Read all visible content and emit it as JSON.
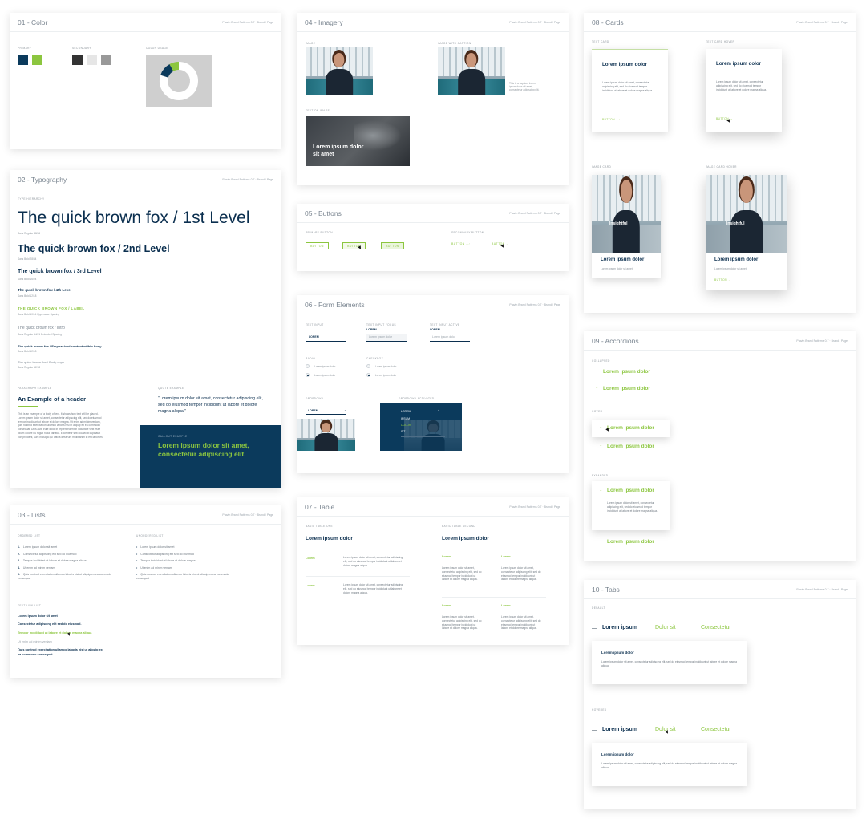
{
  "meta": "Pravin Brand Patterns 0.7",
  "meta_link": "Brand / Page",
  "color": {
    "title": "01 - Color",
    "primary_label": "PRIMARY",
    "secondary_label": "SECONDARY",
    "usage_label": "COLOR USAGE",
    "primary_swatches": [
      "#0b3a5c",
      "#8cc63f"
    ],
    "secondary_swatches": [
      "#333333",
      "#e6e6e6",
      "#999999"
    ],
    "donut": [
      {
        "color": "#ffffff",
        "value": 80
      },
      {
        "color": "#0b3a5c",
        "value": 12
      },
      {
        "color": "#8cc63f",
        "value": 8
      }
    ]
  },
  "typography": {
    "title": "02 - Typography",
    "type_label": "TYPE HIERARCHY",
    "levels": [
      {
        "text": "The quick brown fox / 1st Level",
        "note": "Sans Regular 48/56"
      },
      {
        "text": "The quick brown fox / 2nd Level",
        "note": "Sans Bold 28/34"
      },
      {
        "text": "The quick brown fox / 3rd Level",
        "note": "Sans Bold 16/24"
      },
      {
        "text": "The quick brown fox / 4th Level",
        "note": "Sans Bold 12/18"
      },
      {
        "text": "THE QUICK BROWN FOX / LABEL",
        "note": "Sans Bold 10/14 Uppercase Spacing"
      },
      {
        "text": "The quick brown fox / Intro",
        "note": "Sans Regular 14/21 Extended Spacing"
      },
      {
        "text": "The quick brown fox / Emphasized content within body",
        "note": "Sans Bold 12/18"
      },
      {
        "text": "The quick brown fox / Body copy",
        "note": "Sans Regular 12/18"
      }
    ],
    "paragraph_label": "PARAGRAPH EXAMPLE",
    "paragraph_header": "An Example of a header",
    "paragraph_body": "This is an example of a body of text. It shows how text will be placed. Lorem ipsum dolor sit amet, consectetur adipiscing elit, sed do eiusmod tempor incididunt ut labore et dolore magna. Ut enim ad minim veniam, quis nostrud exercitation ullamco laboris nisi ut aliquip ex ea commodo consequat. Duis aute irure dolor in reprehenderit in voluptate velit esse cillum dolore eu fugiat nulla pariatur. Excepteur sint occaecat cupidatat non proident, sunt in culpa qui officia deserunt mollit anim id est laborum.",
    "quote_label": "QUOTE EXAMPLE",
    "quote": "\"Lorem ipsum dolor sit amet, consectetur adipiscing elit, sed do eiusmod tempor incididunt ut labore et dolore magna aliqua.\"",
    "callout_label": "CALLOUT EXAMPLE",
    "callout": "Lorem ipsum dolor sit amet, consectetur adipiscing elit."
  },
  "lists": {
    "title": "03 - Lists",
    "ordered_label": "ORDERED LIST",
    "unordered_label": "UNORDERED LIST",
    "ordered": [
      "Lorem ipsum dolor sit amet",
      "Consectetur adipiscing elit sed do eiusmod",
      "Tempor incididunt ut labore et dolore magna aliqua",
      "Ut enim ad minim veniam",
      "Quis nostrud exercitation ullamco laboris nisi ut aliquip ex ea commodo consequat"
    ],
    "unordered": [
      "Lorem ipsum dolor sit amet",
      "Consectetur adipiscing elit sed do eiusmod",
      "Tempor incididunt ut labore et dolore magna",
      "Ut enim ad minim veniam",
      "Quis nostrud exercitation ullamco laboris nisi ut aliquip ex ea commodo consequat"
    ],
    "link_label": "TEXT LINK LIST",
    "links": [
      "Lorem ipsum dolor sit amet",
      "Consectetur adipiscing elit sed do eiusmod.",
      "Tempor incididunt ut labore et dolore magna aliqua",
      "Ut enim ad minim veniam",
      "Quis nostrud exercitation ullamco laboris nisi ut aliquip ex ea commodo consequat."
    ]
  },
  "imagery": {
    "title": "04 - Imagery",
    "image_label": "IMAGE",
    "caption_label": "IMAGE WITH CAPTION",
    "caption": "This is a caption. Lorem ipsum dolor sit amet, consectetur adipiscing elit.",
    "text_label": "TEXT ON IMAGE",
    "overlay": "Lorem ipsum dolor sit amet"
  },
  "buttons": {
    "title": "05 - Buttons",
    "primary_label": "PRIMARY BUTTON",
    "secondary_label": "SECONDARY BUTTON",
    "label": "BUTTON"
  },
  "forms": {
    "title": "06 - Form Elements",
    "text_input_label": "TEXT INPUT",
    "focus_label": "TEXT INPUT FOCUS",
    "active_label": "TEXT INPUT ACTIVE",
    "input_value": "LOREM",
    "placeholder": "Lorem ipsum dolor",
    "radio_label": "RADIO",
    "checkbox_label": "CHECKBOX",
    "option": "Lorem ipsum dolor",
    "dropdown_label": "DROPDOWN",
    "dropdown_active_label": "DROPDOWN ACTIVATED",
    "dropdown_value": "LOREM",
    "dropdown_items": [
      "LOREM",
      "IPSUM",
      "DOLOR",
      "SIT"
    ]
  },
  "table": {
    "title": "07 - Table",
    "basic_label": "BASIC TABLE ONE",
    "multi_label": "BASIC TABLE SECOND",
    "heading": "Lorem ipsum dolor",
    "key": "Lorem",
    "cell": "Lorem ipsum dolor sit amet, consectetur adipiscing elit, sed do eiusmod tempor incididunt ut labore et dolore magna aliqua."
  },
  "cards": {
    "title": "08 - Cards",
    "text_label": "TEXT CARD",
    "text_hover_label": "TEXT CARD HOVER",
    "image_label": "IMAGE CARD",
    "image_hover_label": "IMAGE CARD HOVER",
    "heading": "Lorem ipsum dolor",
    "body": "Lorem ipsum dolor sit amet, consectetur adipiscing elit, sed do eiusmod tempor incididunt ut labore et dolore magna aliqua.",
    "short": "Lorem ipsum dolor sit amet",
    "button": "BUTTON",
    "badge": "Insightful"
  },
  "accordions": {
    "title": "09 - Accordions",
    "collapsed_label": "COLLAPSED",
    "hover_label": "HOVER",
    "expanded_label": "EXPANDED",
    "item": "Lorem ipsum dolor",
    "body": "Lorem ipsum dolor sit amet, consectetur adipiscing elit, sed do eiusmod tempor incididunt ut labore et dolore magna aliqua."
  },
  "tabs": {
    "title": "10 - Tabs",
    "default_label": "DEFAULT",
    "hover_label": "HOVERED",
    "items": [
      "Lorem ipsum",
      "Dolor sit",
      "Consectetur"
    ],
    "panel_heading": "Lorem ipsum dolor",
    "panel_body": "Lorem ipsum dolor sit amet, consectetur adipiscing elit, sed do eiusmod tempor incididunt ut labore et dolore magna aliqua."
  }
}
